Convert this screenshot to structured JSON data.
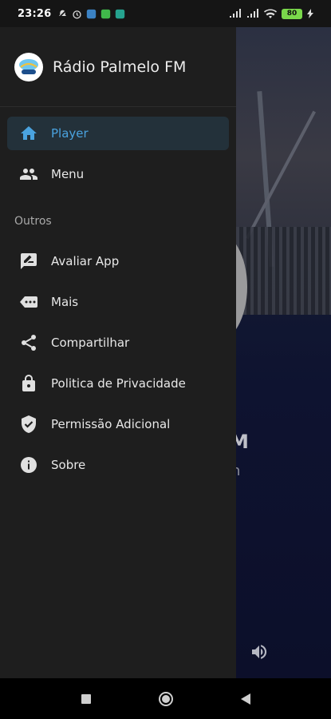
{
  "status_bar": {
    "time": "23:26",
    "battery": "80"
  },
  "drawer": {
    "app_title": "Rádio Palmelo FM",
    "main_items": [
      {
        "label": "Player",
        "icon": "home-icon",
        "active": true
      },
      {
        "label": "Menu",
        "icon": "people-icon",
        "active": false
      }
    ],
    "section_label": "Outros",
    "other_items": [
      {
        "label": "Avaliar App",
        "icon": "rate-review-icon"
      },
      {
        "label": "Mais",
        "icon": "more-dots-icon"
      },
      {
        "label": "Compartilhar",
        "icon": "share-icon"
      },
      {
        "label": "Politica de Privacidade",
        "icon": "lock-icon"
      },
      {
        "label": "Permissão Adicional",
        "icon": "shield-check-icon"
      },
      {
        "label": "Sobre",
        "icon": "info-icon"
      }
    ]
  },
  "background_app": {
    "title_fragment": "M",
    "subtitle_fragment": "n"
  },
  "colors": {
    "accent": "#4aa3df",
    "drawer_bg": "#1e1e1e",
    "active_bg": "#23313a",
    "battery": "#7ad84b"
  }
}
